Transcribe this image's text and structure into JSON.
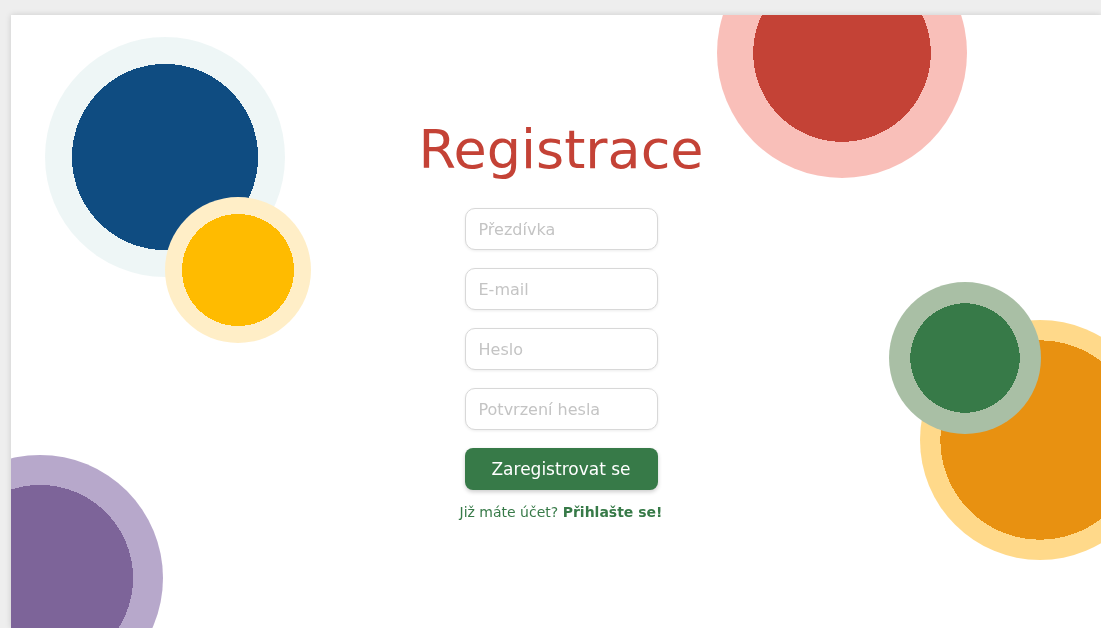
{
  "title": "Registrace",
  "fields": [
    {
      "placeholder": "Přezdívka"
    },
    {
      "placeholder": "E-mail"
    },
    {
      "placeholder": "Heslo"
    },
    {
      "placeholder": "Potvrzení hesla"
    }
  ],
  "submit_button": "Zaregistrovat se",
  "login_prompt": {
    "text": "Již máte účet?",
    "link": "Přihlašte se!"
  }
}
